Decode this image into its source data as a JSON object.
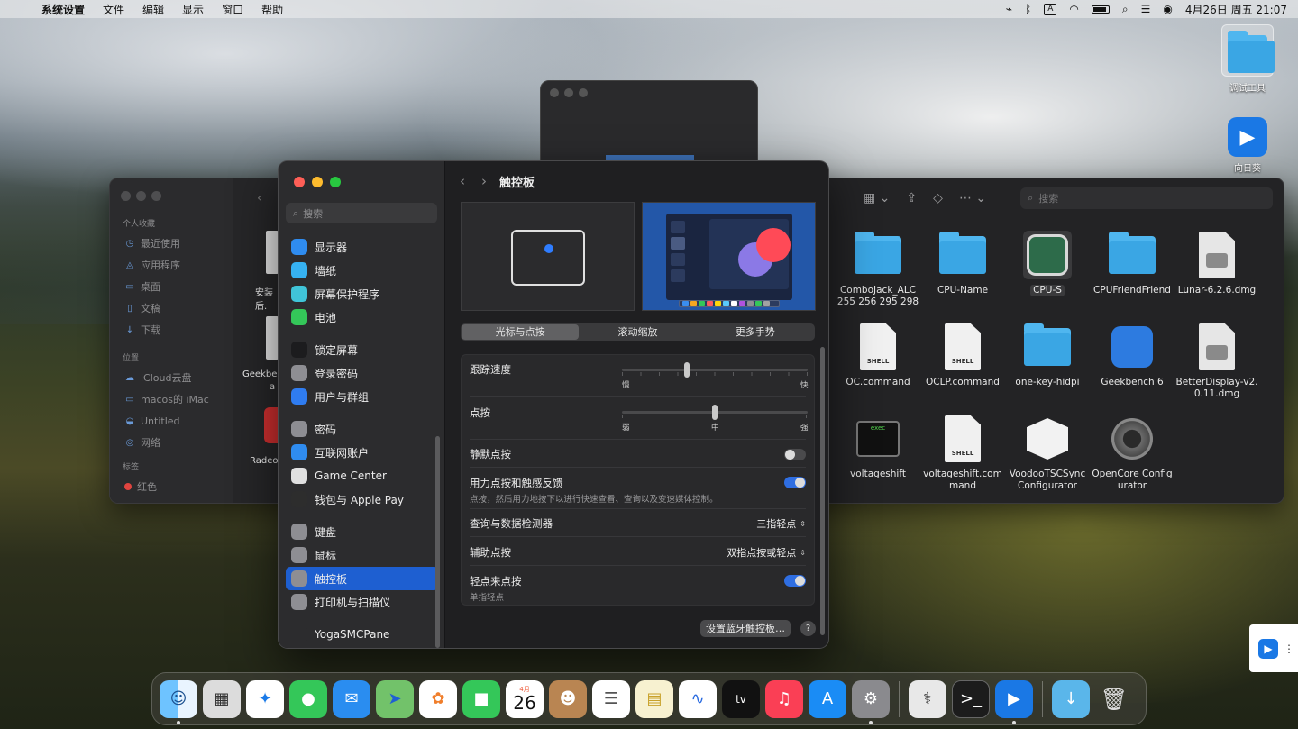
{
  "menubar": {
    "app_name": "系统设置",
    "menus": [
      "文件",
      "编辑",
      "显示",
      "窗口",
      "帮助"
    ],
    "ime_badge": "A",
    "clock": "4月26日 周五  21:07"
  },
  "desktop": {
    "items": [
      {
        "label": "调试工具",
        "icon": "folder-icon"
      },
      {
        "label": "向日葵",
        "icon": "sunlogin-icon"
      }
    ]
  },
  "finder": {
    "sidebar": {
      "favorites_title": "个人收藏",
      "favorites": [
        "最近使用",
        "应用程序",
        "桌面",
        "文稿",
        "下载"
      ],
      "locations_title": "位置",
      "locations": [
        "iCloud云盘",
        "macos的 iMac",
        "Untitled",
        "网络"
      ],
      "tags_title": "标签",
      "tags": [
        "红色"
      ]
    },
    "search_placeholder": "搜索",
    "partial_labels": [
      "安装后.",
      "Geekbe",
      "a",
      "Radeo"
    ],
    "files": [
      {
        "label": "ComboJack_ALC 255 256 295 298",
        "kind": "folder"
      },
      {
        "label": "CPU-Name",
        "kind": "folder"
      },
      {
        "label": "CPU-S",
        "kind": "app-cpus",
        "selected": true
      },
      {
        "label": "CPUFriendFriend",
        "kind": "folder"
      },
      {
        "label": "Lunar-6.2.6.dmg",
        "kind": "dmg"
      },
      {
        "label": "OC.command",
        "kind": "shell"
      },
      {
        "label": "OCLP.command",
        "kind": "shell"
      },
      {
        "label": "one-key-hidpi",
        "kind": "folder"
      },
      {
        "label": "Geekbench 6",
        "kind": "app-geek"
      },
      {
        "label": "BetterDisplay-v2.0.11.dmg",
        "kind": "dmg"
      },
      {
        "label": "voltageshift",
        "kind": "exec"
      },
      {
        "label": "voltageshift.command",
        "kind": "shell"
      },
      {
        "label": "VoodooTSCSync Configurator",
        "kind": "app-voodoo"
      },
      {
        "label": "OpenCore Configurator",
        "kind": "app-gear"
      }
    ],
    "shell_tag": "SHELL",
    "exec_tag": "exec"
  },
  "settings": {
    "search_placeholder": "搜索",
    "title": "触控板",
    "sidebar_groups": [
      [
        {
          "label": "显示器",
          "icon": "display-icon",
          "color": "#2f8cf0"
        },
        {
          "label": "墙纸",
          "icon": "wallpaper-icon",
          "color": "#36b2f2"
        },
        {
          "label": "屏幕保护程序",
          "icon": "screensaver-icon",
          "color": "#40c4d8"
        },
        {
          "label": "电池",
          "icon": "battery-icon",
          "color": "#34c759"
        }
      ],
      [
        {
          "label": "锁定屏幕",
          "icon": "lock-icon",
          "color": "#1c1c1e"
        },
        {
          "label": "登录密码",
          "icon": "password-icon",
          "color": "#8e8e93"
        },
        {
          "label": "用户与群组",
          "icon": "users-icon",
          "color": "#2f7cf0"
        }
      ],
      [
        {
          "label": "密码",
          "icon": "key-icon",
          "color": "#8e8e93"
        },
        {
          "label": "互联网账户",
          "icon": "at-icon",
          "color": "#2f8cf0"
        },
        {
          "label": "Game Center",
          "icon": "gamecenter-icon",
          "color": "#e0e0e0"
        },
        {
          "label": "钱包与 Apple Pay",
          "icon": "wallet-icon",
          "color": "#2d2d2d"
        }
      ],
      [
        {
          "label": "键盘",
          "icon": "keyboard-icon",
          "color": "#8e8e93"
        },
        {
          "label": "鼠标",
          "icon": "mouse-icon",
          "color": "#8e8e93"
        },
        {
          "label": "触控板",
          "icon": "trackpad-icon",
          "color": "#8e8e93",
          "active": true
        },
        {
          "label": "打印机与扫描仪",
          "icon": "printer-icon",
          "color": "#8e8e93"
        }
      ],
      [
        {
          "label": "YogaSMCPane",
          "icon": "yoga-icon",
          "color": "#2c2c2e"
        }
      ]
    ],
    "tabs": [
      {
        "label": "光标与点按",
        "active": true
      },
      {
        "label": "滚动缩放",
        "active": false
      },
      {
        "label": "更多手势",
        "active": false
      }
    ],
    "tracking": {
      "label": "跟踪速度",
      "min": "慢",
      "max": "快",
      "level": 0.35
    },
    "click": {
      "label": "点按",
      "min": "弱",
      "mid": "中",
      "max": "强",
      "level": 0.5
    },
    "silent_click": {
      "label": "静默点按",
      "on": false
    },
    "force_click": {
      "label": "用力点按和触感反馈",
      "desc": "点按，然后用力地按下以进行快速查看、查询以及变速媒体控制。",
      "on": true
    },
    "lookup": {
      "label": "查询与数据检测器",
      "value": "三指轻点"
    },
    "secondary_click": {
      "label": "辅助点按",
      "value": "双指点按或轻点"
    },
    "tap_to_click": {
      "label": "轻点来点按",
      "desc": "单指轻点",
      "on": true
    },
    "bt_button": "设置蓝牙触控板…",
    "help": "?"
  },
  "dock": {
    "calendar_month": "4月",
    "calendar_day": "26",
    "tv_label": "tv",
    "apps": [
      "finder-icon",
      "launchpad-icon",
      "safari-icon",
      "messages-icon",
      "mail-icon",
      "maps-icon",
      "photos-icon",
      "facetime-icon",
      "calendar-icon",
      "contacts-icon",
      "reminders-icon",
      "notes-icon",
      "freeform-icon",
      "appletv-icon",
      "music-icon",
      "appstore-icon",
      "system-settings-icon"
    ]
  }
}
